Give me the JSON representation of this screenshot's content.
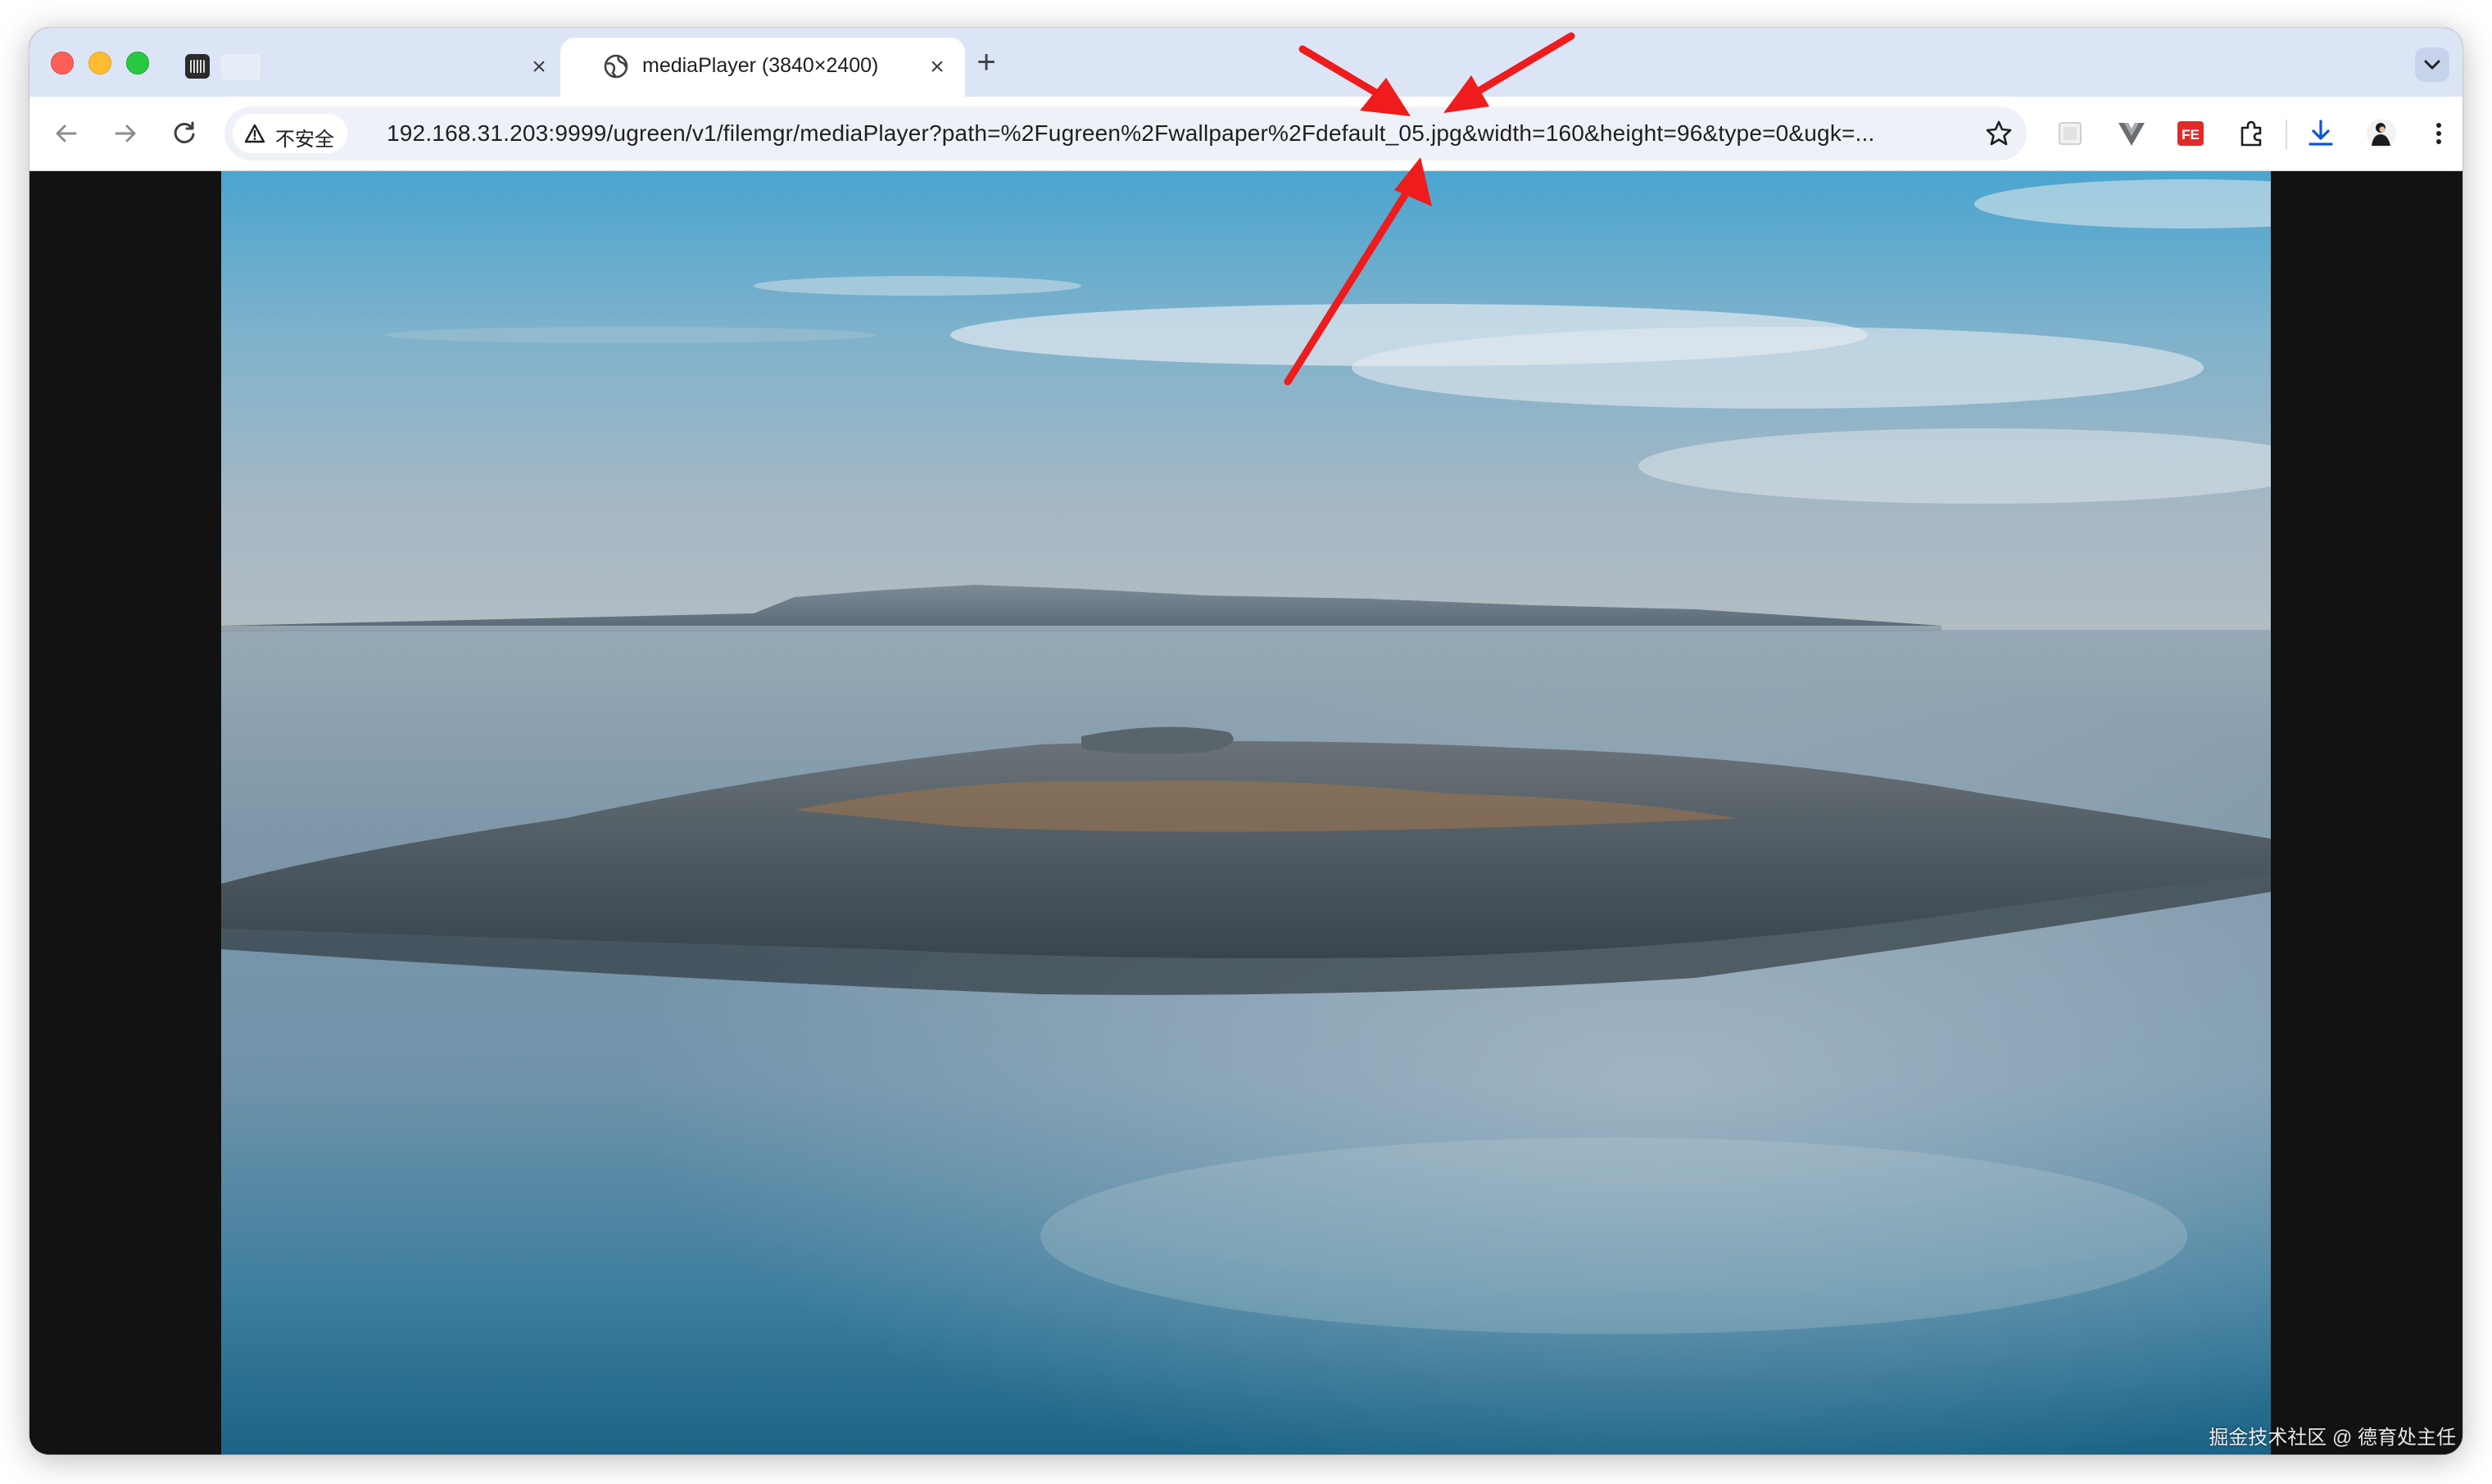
{
  "tabs": [
    {
      "title": "",
      "close_glyph": "×"
    },
    {
      "title": "mediaPlayer (3840×2400)",
      "close_glyph": "×"
    }
  ],
  "new_tab_glyph": "+",
  "omnibox": {
    "security_label": "不安全",
    "url": "192.168.31.203:9999/ugreen/v1/filemgr/mediaPlayer?path=%2Fugreen%2Fwallpaper%2Fdefault_05.jpg&width=160&height=96&type=0&ugk=..."
  },
  "icons": {
    "back": "arrow-left-icon",
    "forward": "arrow-right-icon",
    "reload": "reload-icon",
    "warning": "warning-icon",
    "star": "star-icon",
    "download": "download-icon",
    "menu": "kebab-menu-icon"
  },
  "watermark": "掘金技术社区 @ 德育处主任",
  "colors": {
    "tabstrip": "#dbe5f6",
    "annotation_arrow": "#ee1c1c",
    "viewer_bg": "#121212"
  }
}
